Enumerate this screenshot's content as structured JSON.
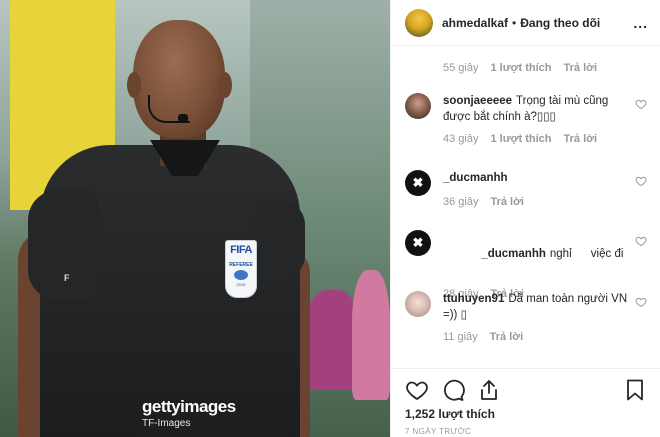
{
  "header": {
    "username": "ahmedalkaf",
    "separator": "•",
    "follow_status": "Đang theo dõi",
    "more": "..."
  },
  "photo": {
    "badge_brand": "FIFA",
    "badge_role": "REFEREE",
    "badge_year": "2019",
    "sleeve_logo": "F",
    "watermark": "gettyimages",
    "watermark_credit": "TF-Images"
  },
  "comments": {
    "top_meta": {
      "time": "55 giây",
      "likes": "1 lượt thích",
      "reply": "Trả lời"
    },
    "items": [
      {
        "user": "soonjaeeeee",
        "text": "Trọng tài mù cũng được bắt chính à?▯▯▯",
        "time": "43 giây",
        "likes": "1 lượt thích",
        "reply": "Trả lời",
        "avatar": "face"
      },
      {
        "user": "_ducmanhh",
        "text": "",
        "time": "36 giây",
        "likes": "",
        "reply": "Trả lời",
        "avatar": "x"
      },
      {
        "user": "_ducmanhh",
        "text": "nghỉ      việc đi",
        "time": "28 giây",
        "likes": "",
        "reply": "Trả lời",
        "avatar": "x"
      },
      {
        "user": "ttuhuyen91",
        "text": "Dã man toàn người VN =)) ▯",
        "time": "11 giây",
        "likes": "",
        "reply": "Trả lời",
        "avatar": "girl"
      }
    ]
  },
  "actions": {
    "likes": "1,252 lượt thích",
    "posted": "7 NGÀY TRƯỚC"
  },
  "icons": [
    "heart-icon",
    "comment-icon",
    "share-icon",
    "bookmark-icon",
    "more-icon"
  ]
}
